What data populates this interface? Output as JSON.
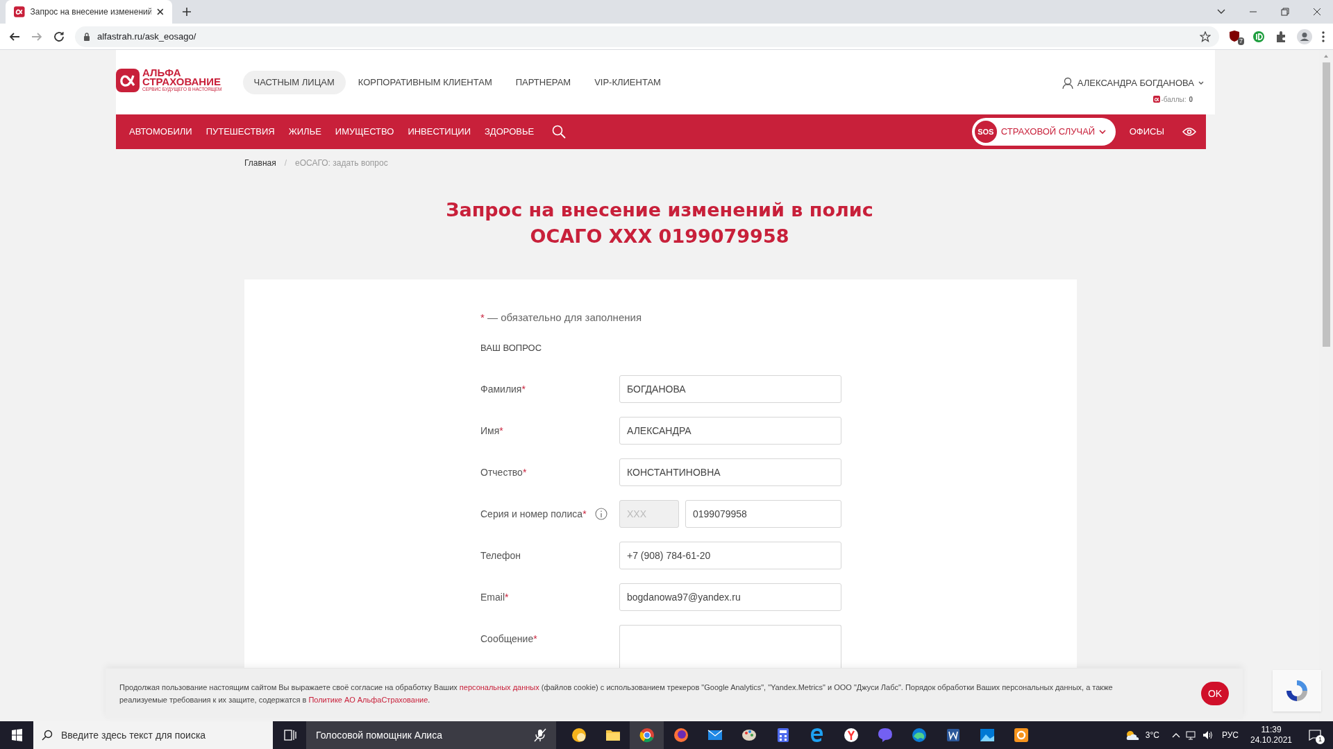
{
  "browser": {
    "tab": {
      "title": "Запрос на внесение изменений",
      "selected": true
    },
    "address": {
      "domain": "alfastrah.ru",
      "path": "/ask_eosago/"
    },
    "extension_badge": "7"
  },
  "header": {
    "logo": {
      "line1": "АЛЬФА",
      "line2": "СТРАХОВАНИЕ",
      "tagline": "СЕРВИС БУДУЩЕГО В НАСТОЯЩЕМ"
    },
    "segments": [
      {
        "label": "ЧАСТНЫМ ЛИЦАМ",
        "selected": true
      },
      {
        "label": "КОРПОРАТИВНЫМ КЛИЕНТАМ",
        "selected": false
      },
      {
        "label": "ПАРТНЕРАМ",
        "selected": false
      },
      {
        "label": "VIP-КЛИЕНТАМ",
        "selected": false
      }
    ],
    "user": {
      "name": "АЛЕКСАНДРА БОГДАНОВА",
      "points_label": "-баллы:",
      "points": "0"
    }
  },
  "nav": {
    "items": [
      "АВТОМОБИЛИ",
      "ПУТЕШЕСТВИЯ",
      "ЖИЛЬЕ",
      "ИМУЩЕСТВО",
      "ИНВЕСТИЦИИ",
      "ЗДОРОВЬЕ"
    ],
    "sos_badge": "SOS",
    "sos_label": "СТРАХОВОЙ СЛУЧАЙ",
    "offices": "ОФИСЫ"
  },
  "breadcrumbs": [
    {
      "label": "Главная",
      "current": false
    },
    {
      "label": "еОСАГО: задать вопрос",
      "current": true
    }
  ],
  "breadcrumb_separator": "/",
  "title_lines": [
    "Запрос на внесение изменений в полис",
    "ОСАГО XXX 0199079958"
  ],
  "form": {
    "required_mark": "*",
    "required_note": "— обязательно для заполнения",
    "section": "ВАШ ВОПРОС",
    "fields": [
      {
        "kind": "text",
        "label": "Фамилия",
        "required": true,
        "value": "БОГДАНОВА"
      },
      {
        "kind": "text",
        "label": "Имя",
        "required": true,
        "value": "АЛЕКСАНДРА"
      },
      {
        "kind": "text",
        "label": "Отчество",
        "required": true,
        "value": "КОНСТАНТИНОВНА"
      },
      {
        "kind": "policy",
        "label": "Серия и номер полиса",
        "required": true,
        "series_placeholder": "XXX",
        "value": "0199079958"
      },
      {
        "kind": "text",
        "label": "Телефон",
        "required": false,
        "value": "+7 (908) 784-61-20"
      },
      {
        "kind": "text",
        "label": "Email",
        "required": true,
        "value": "bogdanowa97@yandex.ru"
      },
      {
        "kind": "textarea",
        "label": "Сообщение",
        "required": true
      }
    ]
  },
  "cookie_banner": {
    "parts": [
      {
        "kind": "text",
        "text": "Продолжая пользование настоящим сайтом Вы выражаете своё согласие на обработку Ваших "
      },
      {
        "kind": "link",
        "text": "персональных данных"
      },
      {
        "kind": "text",
        "text": " (файлов cookie) с использованием трекеров \"Google Analytics\",  \"Yandex.Metrics\" и ООО \"Джуси Лабс\". Порядок обработки Ваших персональных данных, а также реализуемые требования к их защите, содержатся в "
      },
      {
        "kind": "link",
        "text": "Политике АО АльфаСтрахование"
      },
      {
        "kind": "text",
        "text": "."
      }
    ],
    "button": "OK"
  },
  "taskbar": {
    "search_placeholder": "Введите здесь текст для поиска",
    "assistant": "Голосовой помощник Алиса",
    "temperature": "3°C",
    "language": "РУС",
    "time": "11:39",
    "date": "24.10.2021",
    "notifications": "1"
  }
}
